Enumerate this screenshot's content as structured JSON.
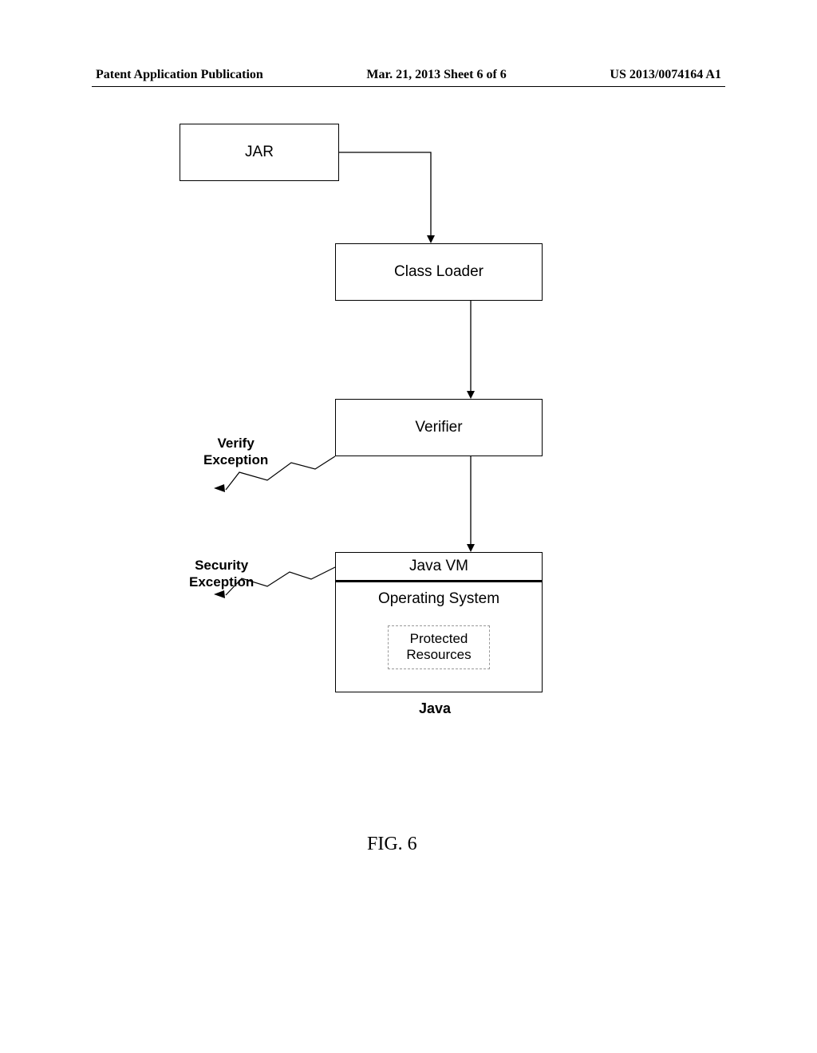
{
  "header": {
    "left": "Patent Application Publication",
    "center": "Mar. 21, 2013  Sheet 6 of 6",
    "right": "US 2013/0074164 A1"
  },
  "boxes": {
    "jar": "JAR",
    "classloader": "Class Loader",
    "verifier": "Verifier",
    "javavm": "Java VM",
    "os": "Operating System",
    "protected": "Protected\nResources"
  },
  "labels": {
    "verify_exception": "Verify\nException",
    "security_exception": "Security\nException",
    "java": "Java"
  },
  "figure": "FIG. 6"
}
